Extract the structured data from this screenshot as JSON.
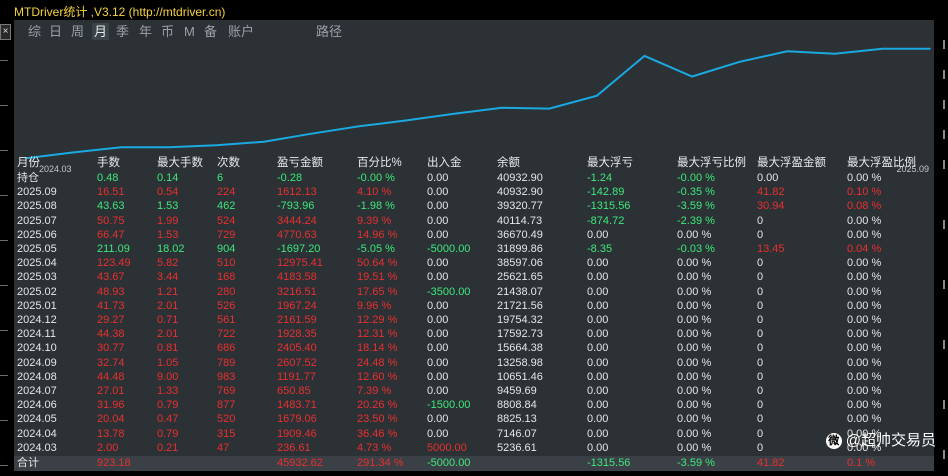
{
  "app": {
    "title": "MTDriver统计 ,V3.12 (http://mtdriver.cn)"
  },
  "tabs": [
    {
      "label": "综",
      "active": false
    },
    {
      "label": "日",
      "active": false
    },
    {
      "label": "周",
      "active": false
    },
    {
      "label": "月",
      "active": true
    },
    {
      "label": "季",
      "active": false
    },
    {
      "label": "年",
      "active": false
    },
    {
      "label": "币",
      "active": false
    },
    {
      "label": "M",
      "active": false
    },
    {
      "label": "备",
      "active": false
    },
    {
      "label": "账户",
      "active": false
    },
    {
      "label": "路径",
      "active": false
    }
  ],
  "chart_data": {
    "type": "line",
    "x": [
      "2024.03",
      "2024.04",
      "2024.05",
      "2024.06",
      "2024.07",
      "2024.08",
      "2024.09",
      "2024.10",
      "2024.11",
      "2024.12",
      "2025.01",
      "2025.02",
      "2025.03",
      "2025.04",
      "2025.05",
      "2025.06",
      "2025.07",
      "2025.08",
      "2025.09",
      "持仓"
    ],
    "series": [
      {
        "values": [
          5236.61,
          7146.07,
          8825.13,
          8808.84,
          9459.69,
          10651.46,
          13258.98,
          15664.38,
          17592.73,
          19754.32,
          21721.56,
          21438.07,
          25621.65,
          38597.06,
          31899.86,
          36670.49,
          40114.73,
          39320.77,
          40932.9,
          40932.9
        ]
      }
    ],
    "xlabel_start": "2024.03",
    "xlabel_end": "2025.09",
    "line_color": "#1aa9e0",
    "grid": false
  },
  "table": {
    "headers": [
      "月份",
      "手数",
      "最大手数",
      "次数",
      "盈亏金额",
      "百分比%",
      "出入金",
      "余额",
      "最大浮亏",
      "最大浮亏比例",
      "最大浮盈金额",
      "最大浮盈比例"
    ],
    "rows": [
      {
        "c": [
          "持仓",
          "0.48",
          "0.14",
          "6",
          "-0.28",
          "-0.00 %",
          "0.00",
          "40932.90",
          "-1.24",
          "-0.00 %",
          "0.00",
          "0.00 %"
        ],
        "k": [
          "w",
          "g",
          "g",
          "g",
          "g",
          "g",
          "w",
          "w",
          "g",
          "g",
          "w",
          "w"
        ]
      },
      {
        "c": [
          "2025.09",
          "16.51",
          "0.54",
          "224",
          "1612.13",
          "4.10 %",
          "0.00",
          "40932.90",
          "-142.89",
          "-0.35 %",
          "41.82",
          "0.10 %"
        ],
        "k": [
          "w",
          "r",
          "r",
          "r",
          "r",
          "r",
          "w",
          "w",
          "g",
          "g",
          "r",
          "r"
        ]
      },
      {
        "c": [
          "2025.08",
          "43.63",
          "1.53",
          "462",
          "-793.96",
          "-1.98 %",
          "0.00",
          "39320.77",
          "-1315.56",
          "-3.59 %",
          "30.94",
          "0.08 %"
        ],
        "k": [
          "w",
          "g",
          "g",
          "g",
          "g",
          "g",
          "w",
          "w",
          "g",
          "g",
          "r",
          "r"
        ]
      },
      {
        "c": [
          "2025.07",
          "50.75",
          "1.99",
          "524",
          "3444.24",
          "9.39 %",
          "0.00",
          "40114.73",
          "-874.72",
          "-2.39 %",
          "0",
          "0.00 %"
        ],
        "k": [
          "w",
          "r",
          "r",
          "r",
          "r",
          "r",
          "w",
          "w",
          "g",
          "g",
          "w",
          "w"
        ]
      },
      {
        "c": [
          "2025.06",
          "66.47",
          "1.53",
          "729",
          "4770.63",
          "14.96 %",
          "0.00",
          "36670.49",
          "0.00",
          "0.00 %",
          "0",
          "0.00 %"
        ],
        "k": [
          "w",
          "r",
          "r",
          "r",
          "r",
          "r",
          "w",
          "w",
          "w",
          "w",
          "w",
          "w"
        ]
      },
      {
        "c": [
          "2025.05",
          "211.09",
          "18.02",
          "904",
          "-1697.20",
          "-5.05 %",
          "-5000.00",
          "31899.86",
          "-8.35",
          "-0.03 %",
          "13.45",
          "0.04 %"
        ],
        "k": [
          "w",
          "g",
          "g",
          "g",
          "g",
          "g",
          "g",
          "w",
          "g",
          "g",
          "r",
          "r"
        ]
      },
      {
        "c": [
          "2025.04",
          "123.49",
          "5.82",
          "510",
          "12975.41",
          "50.64 %",
          "0.00",
          "38597.06",
          "0.00",
          "0.00 %",
          "0",
          "0.00 %"
        ],
        "k": [
          "w",
          "r",
          "r",
          "r",
          "r",
          "r",
          "w",
          "w",
          "w",
          "w",
          "w",
          "w"
        ]
      },
      {
        "c": [
          "2025.03",
          "43.67",
          "3.44",
          "168",
          "4183.58",
          "19.51 %",
          "0.00",
          "25621.65",
          "0.00",
          "0.00 %",
          "0",
          "0.00 %"
        ],
        "k": [
          "w",
          "r",
          "r",
          "r",
          "r",
          "r",
          "w",
          "w",
          "w",
          "w",
          "w",
          "w"
        ]
      },
      {
        "c": [
          "2025.02",
          "48.93",
          "1.21",
          "280",
          "3216.51",
          "17.65 %",
          "-3500.00",
          "21438.07",
          "0.00",
          "0.00 %",
          "0",
          "0.00 %"
        ],
        "k": [
          "w",
          "r",
          "r",
          "r",
          "r",
          "r",
          "g",
          "w",
          "w",
          "w",
          "w",
          "w"
        ]
      },
      {
        "c": [
          "2025.01",
          "41.73",
          "2.01",
          "526",
          "1967.24",
          "9.96 %",
          "0.00",
          "21721.56",
          "0.00",
          "0.00 %",
          "0",
          "0.00 %"
        ],
        "k": [
          "w",
          "r",
          "r",
          "r",
          "r",
          "r",
          "w",
          "w",
          "w",
          "w",
          "w",
          "w"
        ]
      },
      {
        "c": [
          "2024.12",
          "29.27",
          "0.71",
          "561",
          "2161.59",
          "12.29 %",
          "0.00",
          "19754.32",
          "0.00",
          "0.00 %",
          "0",
          "0.00 %"
        ],
        "k": [
          "w",
          "r",
          "r",
          "r",
          "r",
          "r",
          "w",
          "w",
          "w",
          "w",
          "w",
          "w"
        ]
      },
      {
        "c": [
          "2024.11",
          "44.38",
          "2.01",
          "722",
          "1928.35",
          "12.31 %",
          "0.00",
          "17592.73",
          "0.00",
          "0.00 %",
          "0",
          "0.00 %"
        ],
        "k": [
          "w",
          "r",
          "r",
          "r",
          "r",
          "r",
          "w",
          "w",
          "w",
          "w",
          "w",
          "w"
        ]
      },
      {
        "c": [
          "2024.10",
          "30.77",
          "0.81",
          "686",
          "2405.40",
          "18.14 %",
          "0.00",
          "15664.38",
          "0.00",
          "0.00 %",
          "0",
          "0.00 %"
        ],
        "k": [
          "w",
          "r",
          "r",
          "r",
          "r",
          "r",
          "w",
          "w",
          "w",
          "w",
          "w",
          "w"
        ]
      },
      {
        "c": [
          "2024.09",
          "32.74",
          "1.05",
          "789",
          "2607.52",
          "24.48 %",
          "0.00",
          "13258.98",
          "0.00",
          "0.00 %",
          "0",
          "0.00 %"
        ],
        "k": [
          "w",
          "r",
          "r",
          "r",
          "r",
          "r",
          "w",
          "w",
          "w",
          "w",
          "w",
          "w"
        ]
      },
      {
        "c": [
          "2024.08",
          "44.48",
          "9.00",
          "983",
          "1191.77",
          "12.60 %",
          "0.00",
          "10651.46",
          "0.00",
          "0.00 %",
          "0",
          "0.00 %"
        ],
        "k": [
          "w",
          "r",
          "r",
          "r",
          "r",
          "r",
          "w",
          "w",
          "w",
          "w",
          "w",
          "w"
        ]
      },
      {
        "c": [
          "2024.07",
          "27.01",
          "1.33",
          "769",
          "650.85",
          "7.39 %",
          "0.00",
          "9459.69",
          "0.00",
          "0.00 %",
          "0",
          "0.00 %"
        ],
        "k": [
          "w",
          "r",
          "r",
          "r",
          "r",
          "r",
          "w",
          "w",
          "w",
          "w",
          "w",
          "w"
        ]
      },
      {
        "c": [
          "2024.06",
          "31.96",
          "0.79",
          "877",
          "1483.71",
          "20.26 %",
          "-1500.00",
          "8808.84",
          "0.00",
          "0.00 %",
          "0",
          "0.00 %"
        ],
        "k": [
          "w",
          "r",
          "r",
          "r",
          "r",
          "r",
          "g",
          "w",
          "w",
          "w",
          "w",
          "w"
        ]
      },
      {
        "c": [
          "2024.05",
          "20.04",
          "0.47",
          "520",
          "1679.06",
          "23.50 %",
          "0.00",
          "8825.13",
          "0.00",
          "0.00 %",
          "0",
          "0.00 %"
        ],
        "k": [
          "w",
          "r",
          "r",
          "r",
          "r",
          "r",
          "w",
          "w",
          "w",
          "w",
          "w",
          "w"
        ]
      },
      {
        "c": [
          "2024.04",
          "13.78",
          "0.79",
          "315",
          "1909.46",
          "36.46 %",
          "0.00",
          "7146.07",
          "0.00",
          "0.00 %",
          "0",
          "0.00 %"
        ],
        "k": [
          "w",
          "r",
          "r",
          "r",
          "r",
          "r",
          "w",
          "w",
          "w",
          "w",
          "w",
          "w"
        ]
      },
      {
        "c": [
          "2024.03",
          "2.00",
          "0.21",
          "47",
          "236.61",
          "4.73 %",
          "5000.00",
          "5236.61",
          "0.00",
          "0.00 %",
          "0",
          "0.00 %"
        ],
        "k": [
          "w",
          "r",
          "r",
          "r",
          "r",
          "r",
          "r",
          "w",
          "w",
          "w",
          "w",
          "w"
        ]
      }
    ],
    "total": {
      "c": [
        "合计",
        "923.18",
        "",
        "",
        "45932.62",
        "291.34 %",
        "-5000.00",
        "",
        "-1315.56",
        "-3.59 %",
        "41.82",
        "0.1 %"
      ],
      "k": [
        "w",
        "r",
        "w",
        "w",
        "r",
        "r",
        "g",
        "w",
        "g",
        "g",
        "r",
        "r"
      ]
    }
  },
  "colors": {
    "w": "#e6e6e6",
    "r": "#e8302f",
    "g": "#3ee87c"
  },
  "watermark": {
    "text": "@超帅交易员",
    "icon": "weibo-logo-icon"
  }
}
